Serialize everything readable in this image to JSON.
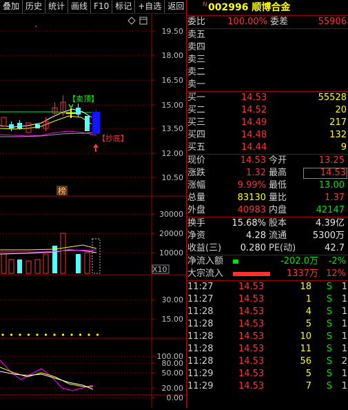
{
  "toolbar": {
    "items": [
      "叠加",
      "历史",
      "统计",
      "画线",
      "F10",
      "标记",
      "+自选",
      "返回"
    ]
  },
  "chart": {
    "price_axis": [
      "19.50",
      "18.00",
      "16.50",
      "15.00",
      "13.50",
      "12.00",
      "10.50"
    ],
    "sell_top_label": "【卖顶】",
    "buy_bottom_label": "【抄底】",
    "bang_label": "榜",
    "volume_axis": [
      "30000",
      "20000",
      "10000"
    ],
    "volume_unit": "X10",
    "ind1_axis": [
      "30.00",
      "15.00"
    ],
    "ind2_axis": [
      "100.00",
      "80.00",
      "50.00",
      "20.00",
      "0.00"
    ]
  },
  "quote": {
    "flag": "N",
    "code": "002996",
    "name": "顺博合金",
    "weibi_label": "委比",
    "weibi_value": "100.00%",
    "weicha_label": "委差",
    "weicha_value": "55906",
    "sells": [
      {
        "label": "卖五",
        "price": "",
        "vol": ""
      },
      {
        "label": "卖四",
        "price": "",
        "vol": ""
      },
      {
        "label": "卖三",
        "price": "",
        "vol": ""
      },
      {
        "label": "卖二",
        "price": "",
        "vol": ""
      },
      {
        "label": "卖一",
        "price": "",
        "vol": ""
      }
    ],
    "buys": [
      {
        "label": "买一",
        "price": "14.53",
        "vol": "55528"
      },
      {
        "label": "买二",
        "price": "14.52",
        "vol": "20"
      },
      {
        "label": "买三",
        "price": "14.49",
        "vol": "217"
      },
      {
        "label": "买四",
        "price": "14.48",
        "vol": "132"
      },
      {
        "label": "买五",
        "price": "14.44",
        "vol": "9"
      }
    ],
    "stats1": [
      {
        "l1": "现价",
        "v1": "14.53",
        "l2": "今开",
        "v2": "13.25"
      },
      {
        "l1": "涨跌",
        "v1": "1.32",
        "l2": "最高",
        "v2": "14.53"
      },
      {
        "l1": "涨幅",
        "v1": "9.99%",
        "l2": "最低",
        "v2": "13.00"
      },
      {
        "l1": "总量",
        "v1": "83130",
        "l2": "量比",
        "v2": "1.37"
      },
      {
        "l1": "外盘",
        "v1": "40983",
        "l2": "内盘",
        "v2": "42147"
      }
    ],
    "stats2": [
      {
        "l1": "换手",
        "v1": "15.68%",
        "l2": "股本",
        "v2": "4.39亿"
      },
      {
        "l1": "净资",
        "v1": "4.28",
        "l2": "流通",
        "v2": "5300万"
      },
      {
        "l1": "收益(三)",
        "v1": "0.280",
        "l2": "PE(动)",
        "v2": "42.7"
      }
    ],
    "flow": [
      {
        "label": "净流入额",
        "amount": "-202.0万",
        "pct": "-2%"
      },
      {
        "label": "大宗流入",
        "amount": "1337万",
        "pct": "12%"
      }
    ],
    "ticks": [
      {
        "time": "11:27",
        "price": "14.53",
        "vol": "18",
        "side": "S",
        "n": "1"
      },
      {
        "time": "11:27",
        "price": "14.53",
        "vol": "1",
        "side": "S",
        "n": "1"
      },
      {
        "time": "11:28",
        "price": "14.53",
        "vol": "4",
        "side": "S",
        "n": "1"
      },
      {
        "time": "11:28",
        "price": "14.53",
        "vol": "5",
        "side": "S",
        "n": "1"
      },
      {
        "time": "11:28",
        "price": "14.53",
        "vol": "10",
        "side": "S",
        "n": "1"
      },
      {
        "time": "11:28",
        "price": "14.53",
        "vol": "11",
        "side": "S",
        "n": "1"
      },
      {
        "time": "11:28",
        "price": "14.53",
        "vol": "56",
        "side": "S",
        "n": "2"
      },
      {
        "time": "11:29",
        "price": "14.53",
        "vol": "5",
        "side": "S",
        "n": "1"
      },
      {
        "time": "11:29",
        "price": "14.53",
        "vol": "7",
        "side": "S",
        "n": "1"
      }
    ]
  },
  "colors": {
    "up": "#ff3232",
    "down": "#54ffff",
    "grid": "#a00000",
    "ma1": "#ffffff",
    "ma2": "#ffff00",
    "ma3": "#ff00ff",
    "ma4": "#00ff00"
  }
}
